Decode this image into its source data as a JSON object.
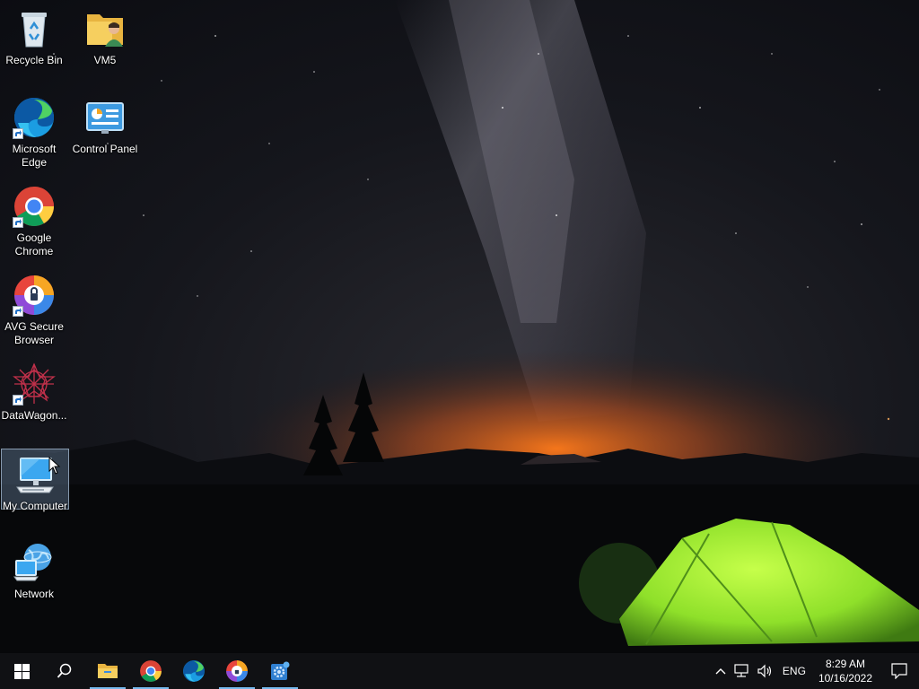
{
  "desktop": {
    "icons": [
      {
        "label": "Recycle Bin",
        "icon": "recycle-bin-icon"
      },
      {
        "label": "VM5",
        "icon": "user-folder-icon"
      },
      {
        "label": "Microsoft Edge",
        "icon": "edge-icon",
        "shortcut": true
      },
      {
        "label": "Control Panel",
        "icon": "control-panel-icon"
      },
      {
        "label": "Google Chrome",
        "icon": "chrome-icon",
        "shortcut": true
      },
      {
        "label": "AVG Secure Browser",
        "icon": "avg-browser-icon",
        "shortcut": true
      },
      {
        "label": "DataWagon...",
        "icon": "datawagon-icon",
        "shortcut": true
      },
      {
        "label": "My Computer",
        "icon": "computer-icon",
        "selected": true
      },
      {
        "label": "Network",
        "icon": "network-icon"
      }
    ]
  },
  "taskbar": {
    "start_icon": "windows-logo-icon",
    "search_icon": "search-icon",
    "pinned": [
      {
        "name": "File Explorer",
        "icon": "folder-icon",
        "running": true
      },
      {
        "name": "Google Chrome",
        "icon": "chrome-icon",
        "running": true
      },
      {
        "name": "Microsoft Edge",
        "icon": "edge-icon",
        "running": false
      },
      {
        "name": "AVG Secure Browser",
        "icon": "avg-browser-icon",
        "running": true
      },
      {
        "name": "App",
        "icon": "gear-app-icon",
        "running": true
      }
    ],
    "tray": {
      "language": "ENG",
      "time": "8:29 AM",
      "date": "10/16/2022"
    }
  },
  "colors": {
    "taskbar_bg": "#101114",
    "running_indicator": "#76b9ed",
    "tent_green": "#8fe02a",
    "horizon_orange": "#ff7a1a"
  }
}
